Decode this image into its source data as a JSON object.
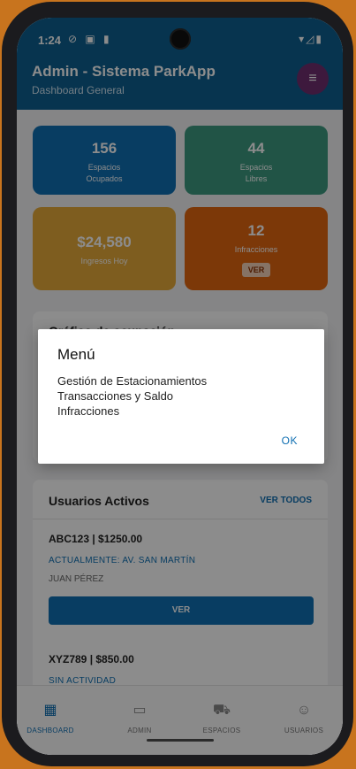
{
  "status": {
    "time": "1:24",
    "left_icons": "⊘ ▣ ▮",
    "right_icons": "▾◿▮"
  },
  "appbar": {
    "title": "Admin - Sistema ParkApp",
    "subtitle": "Dashboard General",
    "menu_icon": "≡"
  },
  "stats": [
    {
      "value": "156",
      "label1": "Espacios",
      "label2": "Ocupados",
      "color": "#0f6fb2"
    },
    {
      "value": "44",
      "label1": "Espacios",
      "label2": "Libres",
      "color": "#3d9a80"
    },
    {
      "value": "$24,580",
      "label1": "Ingresos Hoy",
      "color": "#e5a93a"
    },
    {
      "value": "12",
      "label1": "Infracciones",
      "button": "VER",
      "color": "#e2660f"
    }
  ],
  "chart_panel": {
    "title": "Gráfico de ocupación"
  },
  "users_panel": {
    "title": "Usuarios Activos",
    "see_all": "VER TODOS",
    "users": [
      {
        "header": "ABC123 | $1250.00",
        "status": "ACTUALMENTE: AV. SAN MARTÍN",
        "name": "JUAN PÉREZ",
        "button": "VER"
      },
      {
        "header": "XYZ789 | $850.00",
        "status": "SIN ACTIVIDAD"
      }
    ]
  },
  "bottom_nav": [
    {
      "label": "DASHBOARD",
      "icon": "▦"
    },
    {
      "label": "ADMIN",
      "icon": "▭"
    },
    {
      "label": "ESPACIOS",
      "icon": "⛟"
    },
    {
      "label": "USUARIOS",
      "icon": "☺"
    }
  ],
  "dialog": {
    "title": "Menú",
    "items": [
      "Gestión de Estacionamientos",
      "Transacciones y Saldo",
      "Infracciones"
    ],
    "ok": "OK"
  },
  "colors": {
    "primary": "#0d5f90",
    "accent": "#0f6fb2"
  }
}
